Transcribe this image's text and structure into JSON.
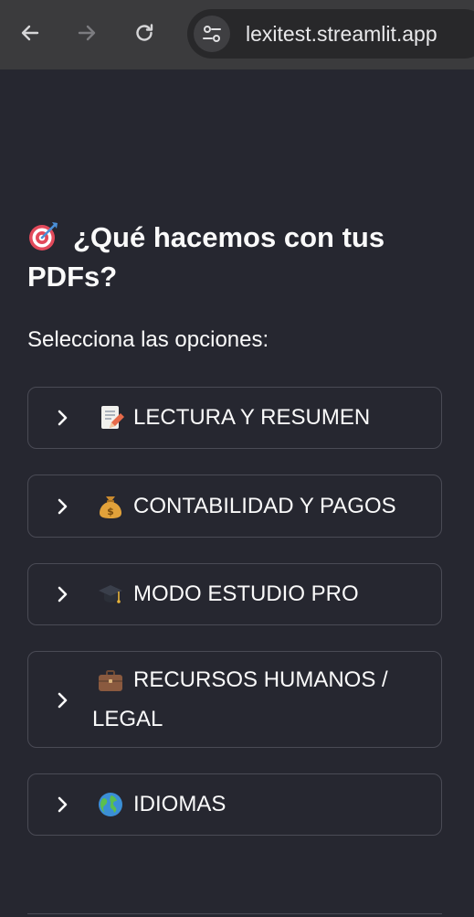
{
  "browser": {
    "url": "lexitest.streamlit.app"
  },
  "page": {
    "heading": "¿Qué hacemos con tus PDFs?",
    "heading_icon": "target-icon",
    "subtitle": "Selecciona las opciones:"
  },
  "expanders": [
    {
      "label": "LECTURA Y RESUMEN",
      "icon": "memo-icon"
    },
    {
      "label": "CONTABILIDAD Y PAGOS",
      "icon": "money-bag-icon"
    },
    {
      "label": "MODO ESTUDIO PRO",
      "icon": "graduation-cap-icon"
    },
    {
      "label_line1": "RECURSOS HUMANOS /",
      "label_line2": "LEGAL",
      "icon": "briefcase-icon"
    },
    {
      "label": "IDIOMAS",
      "icon": "globe-icon"
    }
  ],
  "colors": {
    "background": "#262730",
    "browser_bar": "#3b3b3d",
    "text": "#fafafa",
    "border": "#4a4b55"
  }
}
